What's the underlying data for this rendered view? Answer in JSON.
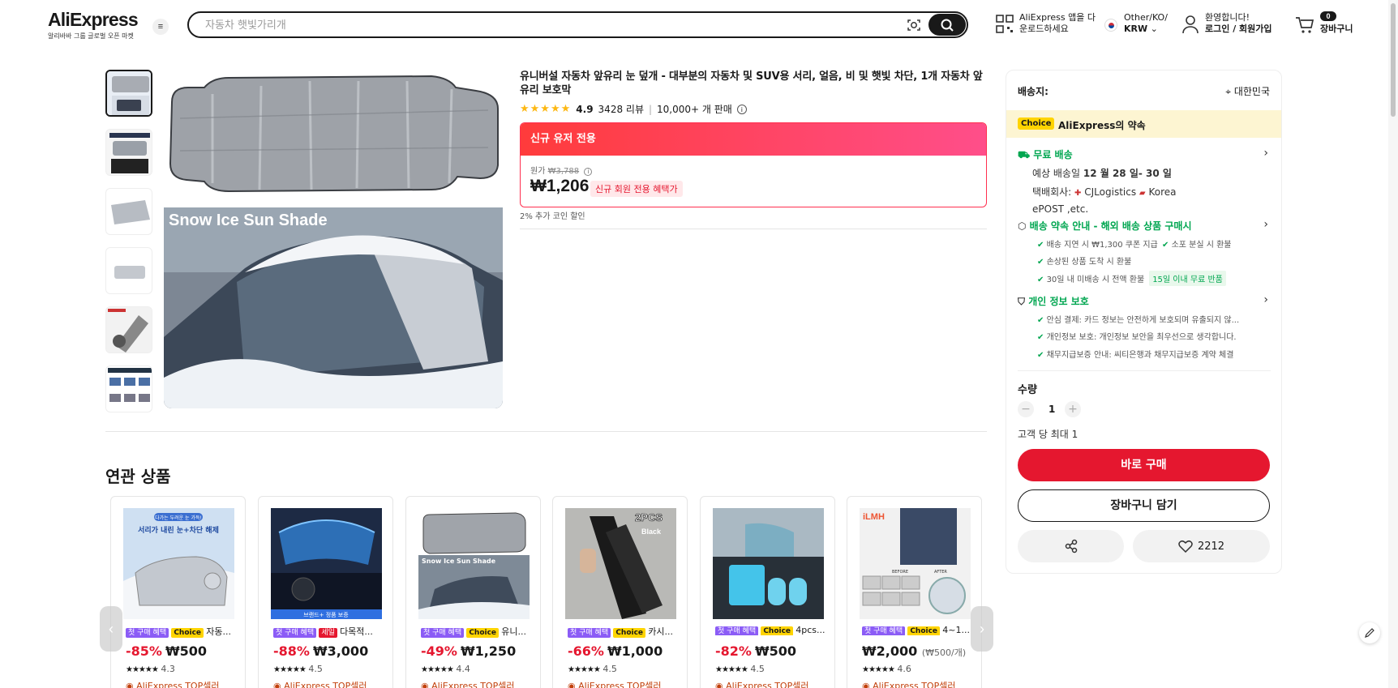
{
  "header": {
    "logo": "AliExpress",
    "logo_sub": "알리바바 그룹 글로벌 오픈 마켓",
    "search_placeholder": "자동차 햇빛가리개",
    "app_line1": "AliExpress 앱을 다",
    "app_line2": "운로드하세요",
    "locale_line1": "Other/KO/",
    "locale_line2": "KRW",
    "account_line1": "환영합니다!",
    "account_line2": "로그인 / 회원가입",
    "cart_count": "0",
    "cart_label": "장바구니"
  },
  "product": {
    "title": "유니버설 자동차 앞유리 눈 덮개 - 대부분의 자동차 및 SUV용 서리, 얼음, 비 및 햇빛 차단, 1개 자동차 앞유리 보호막",
    "rating": "4.9",
    "reviews": "3428 리뷰",
    "sold": "10,000+ 개 판매",
    "image_caption": "Snow Ice Sun Shade",
    "promo_head": "신규 유저 전용",
    "orig_label": "원가",
    "orig_price": "₩3,788",
    "price": "₩1,206",
    "new_badge": "신규 회원 전용 혜택가",
    "coin_text": "2% 추가 코인 할인"
  },
  "panel": {
    "ship_to_label": "배송지:",
    "ship_country": "대한민국",
    "choice_tag": "Choice",
    "choice_text": "AliExpress의 약속",
    "free_ship": "무료 배송",
    "eta_prefix": "예상 배송일",
    "eta": "12 월 28 일- 30 일",
    "carrier_prefix": "택배회사:",
    "carrier1": "CJLogistics",
    "carrier2": "Korea",
    "carrier_line2": "ePOST ,etc.",
    "guarantee_title": "배송 약속 안내 - 해외 배송 상품 구매시",
    "g1": "배송 지연 시 ₩1,300 쿠폰 지급",
    "g2": "소포 분실 시 환불",
    "g3": "손상된 상품 도착 시 환불",
    "g4": "30일 내 미배송 시 전액 환불",
    "g4_tag": "15일 이내 무료 반품",
    "privacy_title": "개인 정보 보호",
    "p1": "안심 결제: 카드 정보는 안전하게 보호되며 유출되지 않...",
    "p2": "개인정보 보호: 개인정보 보안을 최우선으로 생각합니다.",
    "p3": "채무지급보증 안내: 씨티은행과 채무지급보증 계약 체결",
    "qty_label": "수량",
    "qty_minus": "−",
    "qty_value": "1",
    "qty_plus": "+",
    "qty_max": "고객 당 최대 1",
    "buy_label": "바로 구매",
    "cart_label": "장바구니 담기",
    "wish_count": "2212"
  },
  "related": {
    "title": "연관 상품",
    "items": [
      {
        "tag1": "첫 구매 혜택",
        "tag2": "Choice",
        "name": "자동...",
        "discount": "-85%",
        "price": "₩500",
        "unit": "",
        "rating": "4.3",
        "seller": "AliExpress TOP셀러"
      },
      {
        "tag1": "첫 구매 혜택",
        "tag2": "세일",
        "name": "다목적...",
        "discount": "-88%",
        "price": "₩3,000",
        "unit": "",
        "rating": "4.5",
        "seller": "AliExpress TOP셀러"
      },
      {
        "tag1": "첫 구매 혜택",
        "tag2": "Choice",
        "name": "유니...",
        "discount": "-49%",
        "price": "₩1,250",
        "unit": "",
        "rating": "4.4",
        "seller": "AliExpress TOP셀러"
      },
      {
        "tag1": "첫 구매 혜택",
        "tag2": "Choice",
        "name": "카시...",
        "discount": "-66%",
        "price": "₩1,000",
        "unit": "",
        "rating": "4.5",
        "seller": "AliExpress TOP셀러"
      },
      {
        "tag1": "첫 구매 혜택",
        "tag2": "Choice",
        "name": "4pcs...",
        "discount": "-82%",
        "price": "₩500",
        "unit": "",
        "rating": "4.5",
        "seller": "AliExpress TOP셀러"
      },
      {
        "tag1": "첫 구매 혜택",
        "tag2": "Choice",
        "name": "4~1...",
        "discount": "",
        "price": "₩2,000",
        "unit": "(₩500/개)",
        "rating": "4.6",
        "seller": "AliExpress TOP셀러"
      }
    ],
    "card2_banner": "브랜드+ 정품 보증",
    "card4_badge1": "2PCS",
    "card4_badge2": "Black",
    "card1_line1": "다가는 두려운 눈 가득!",
    "card1_line2": "서리가 내린 눈+차단 해제",
    "card3_caption": "Snow Ice Sun Shade",
    "card6_logo": "iLMH",
    "card6_before": "BEFORE",
    "card6_after": "AFTER"
  },
  "colors": {
    "accent": "#e5172f",
    "choice": "#ffd400",
    "green": "#00a650"
  }
}
